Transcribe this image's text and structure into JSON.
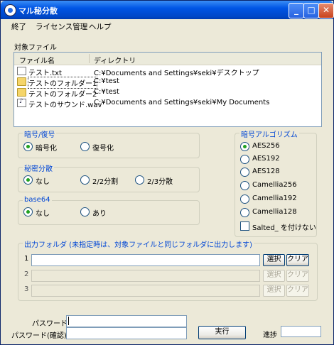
{
  "window": {
    "title": "マル秘分散",
    "min_label": "_",
    "max_label": "□",
    "close_label": "✕"
  },
  "menu": [
    "終了",
    "ライセンス管理",
    "ヘルプ"
  ],
  "target_files": {
    "label": "対象ファイル",
    "columns": [
      "ファイル名",
      "ディレクトリ"
    ],
    "rows": [
      {
        "name": "テスト.txt",
        "dir": "C:¥Documents and Settings¥seki¥デスクトップ",
        "icon": "text-file-icon"
      },
      {
        "name": "テストのフォルダー1",
        "dir": "C:¥test",
        "icon": "folder-icon"
      },
      {
        "name": "テストのフォルダー2",
        "dir": "C:¥test",
        "icon": "folder-icon"
      },
      {
        "name": "テストのサウンド.wav",
        "dir": "C:¥Documents and Settings¥seki¥My Documents",
        "icon": "sound-file-icon"
      }
    ]
  },
  "crypt": {
    "label": "暗号/復号",
    "options": [
      "暗号化",
      "復号化"
    ],
    "selected": 0
  },
  "split": {
    "label": "秘密分散",
    "options": [
      "なし",
      "2/2分割",
      "2/3分散"
    ],
    "selected": 0
  },
  "base64": {
    "label": "base64",
    "options": [
      "なし",
      "あり"
    ],
    "selected": 0
  },
  "algorithm": {
    "label": "暗号アルゴリズム",
    "options": [
      "AES256",
      "AES192",
      "AES128",
      "Camellia256",
      "Camellia192",
      "Camellia128"
    ],
    "selected": 0,
    "salted_label": "Salted_ を付けない",
    "salted_checked": false
  },
  "output": {
    "label": "出力フォルダ (未指定時は、対象ファイルと同じフォルダに出力します)",
    "rows": [
      {
        "num": "1",
        "value": "",
        "enabled": true
      },
      {
        "num": "2",
        "value": "",
        "enabled": false
      },
      {
        "num": "3",
        "value": "",
        "enabled": false
      }
    ],
    "select_label": "選択",
    "clear_label": "クリア"
  },
  "password": {
    "label": "パスワード",
    "confirm_label": "パスワード(確認)",
    "value": "",
    "confirm_value": ""
  },
  "run_label": "実行",
  "progress": {
    "label": "進捗",
    "value": 0
  }
}
